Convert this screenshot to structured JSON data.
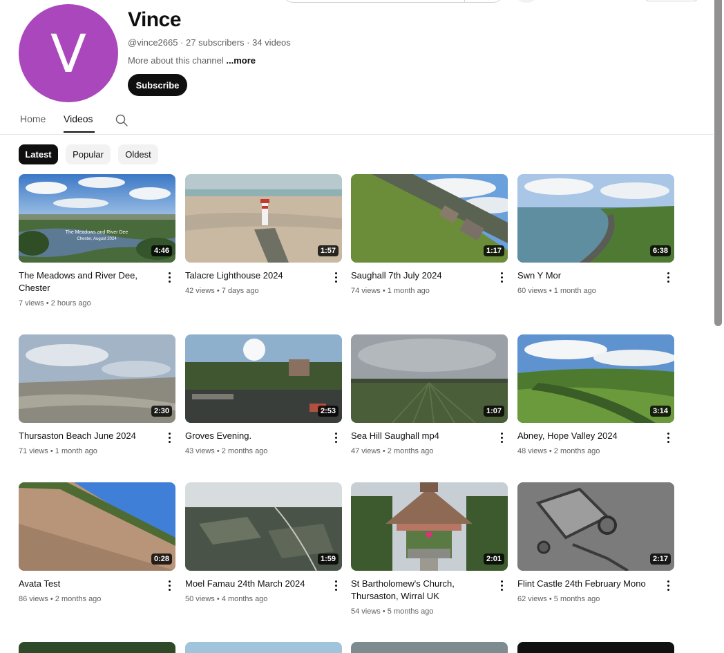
{
  "channel": {
    "avatar_letter": "V",
    "avatar_color": "#ab47bc",
    "name": "Vince",
    "meta": "@vince2665 · 27 subscribers · 34 videos",
    "description": "More about this channel ",
    "more_label": "...more",
    "subscribe_label": "Subscribe"
  },
  "tabs": [
    {
      "label": "Home",
      "active": false
    },
    {
      "label": "Videos",
      "active": true
    }
  ],
  "chips": [
    {
      "label": "Latest",
      "active": true
    },
    {
      "label": "Popular",
      "active": false
    },
    {
      "label": "Oldest",
      "active": false
    }
  ],
  "videos": [
    {
      "title": "The Meadows and River Dee, Chester",
      "views": "7 views",
      "age": "2 hours ago",
      "duration": "4:46",
      "overlay_line1": "The Meadows and River Dee",
      "overlay_line2": "Chester, August 2024"
    },
    {
      "title": "Talacre Lighthouse 2024",
      "views": "42 views",
      "age": "7 days ago",
      "duration": "1:57"
    },
    {
      "title": "Saughall 7th July 2024",
      "views": "74 views",
      "age": "1 month ago",
      "duration": "1:17"
    },
    {
      "title": "Swn Y Mor",
      "views": "60 views",
      "age": "1 month ago",
      "duration": "6:38"
    },
    {
      "title": "Thursaston Beach June 2024",
      "views": "71 views",
      "age": "1 month ago",
      "duration": "2:30"
    },
    {
      "title": "Groves Evening.",
      "views": "43 views",
      "age": "2 months ago",
      "duration": "2:53"
    },
    {
      "title": "Sea Hill Saughall mp4",
      "views": "47 views",
      "age": "2 months ago",
      "duration": "1:07"
    },
    {
      "title": "Abney, Hope Valley 2024",
      "views": "48 views",
      "age": "2 months ago",
      "duration": "3:14"
    },
    {
      "title": "Avata Test",
      "views": "86 views",
      "age": "2 months ago",
      "duration": "0:28"
    },
    {
      "title": "Moel Famau 24th March 2024",
      "views": "50 views",
      "age": "4 months ago",
      "duration": "1:59"
    },
    {
      "title": "St Bartholomew's Church, Thursaston, Wirral UK",
      "views": "54 views",
      "age": "5 months ago",
      "duration": "2:01"
    },
    {
      "title": "Flint Castle 24th February Mono",
      "views": "62 views",
      "age": "5 months ago",
      "duration": "2:17"
    }
  ],
  "stats_separator": " • ",
  "icons": {
    "search": "search-icon",
    "menu": "more-vert-icon"
  }
}
